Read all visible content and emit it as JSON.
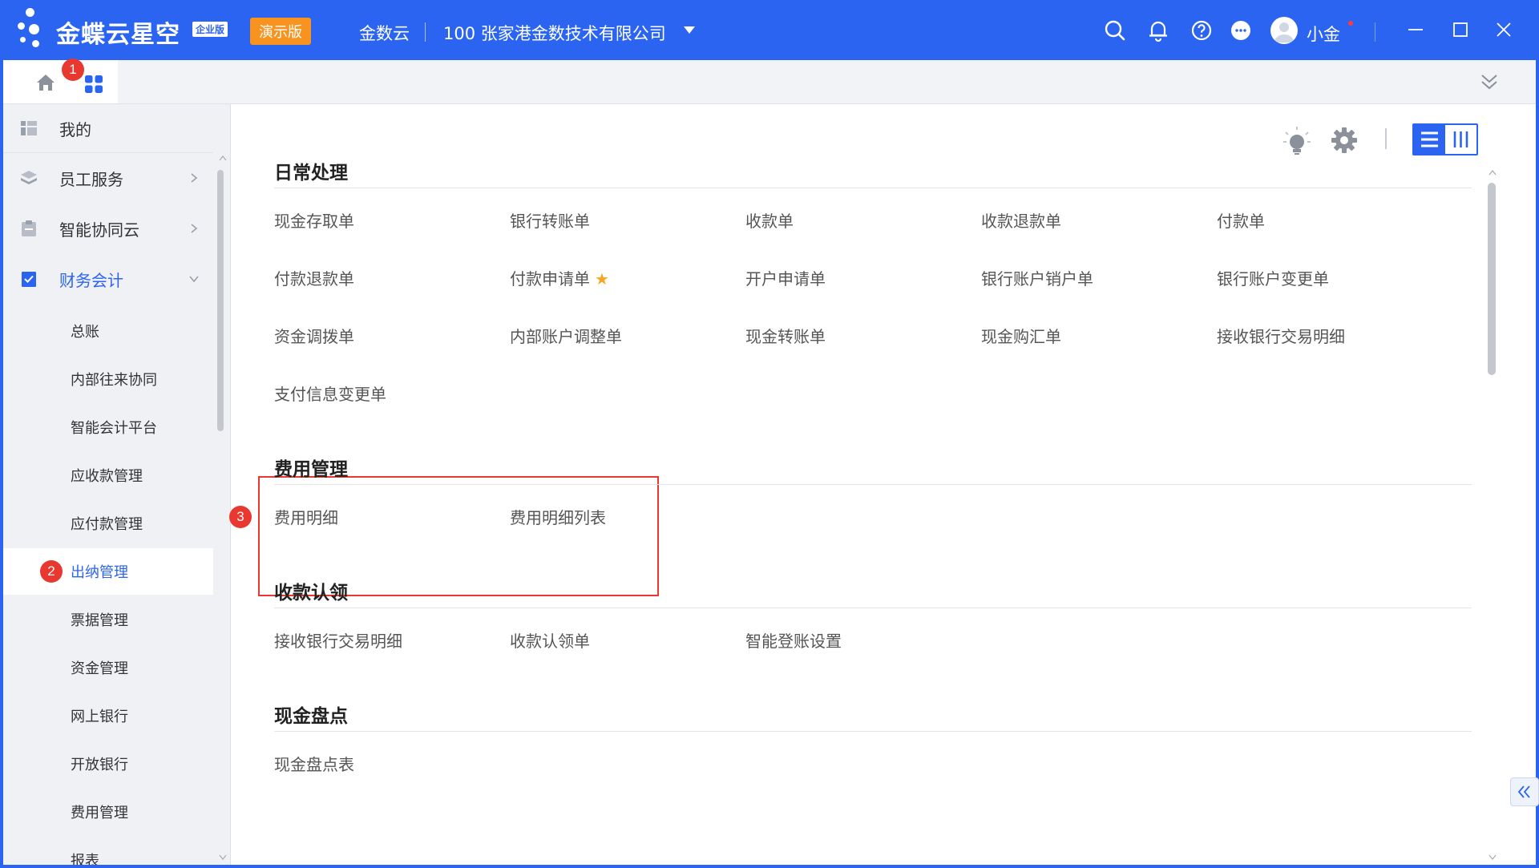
{
  "header": {
    "brand": "金蝶云星空",
    "edition_badge": "企业版",
    "demo_tag": "演示版",
    "app_name": "金数云",
    "org": "100  张家港金数技术有限公司",
    "username": "小金"
  },
  "tabs": {
    "home_icon": "home-icon",
    "apps_icon": "apps-grid-icon",
    "badge_1": "1"
  },
  "sidebar": {
    "items": [
      {
        "label": "我的",
        "icon": "my-icon"
      },
      {
        "label": "员工服务",
        "icon": "layers-icon"
      },
      {
        "label": "智能协同云",
        "icon": "clipboard-icon"
      },
      {
        "label": "财务会计",
        "icon": "finance-icon"
      }
    ],
    "sub_items": [
      "总账",
      "内部往来协同",
      "智能会计平台",
      "应收款管理",
      "应付款管理",
      "出纳管理",
      "票据管理",
      "资金管理",
      "网上银行",
      "开放银行",
      "费用管理",
      "报表"
    ],
    "badge_2": "2"
  },
  "main": {
    "sections": [
      {
        "title": "日常处理",
        "links": [
          "现金存取单",
          "银行转账单",
          "收款单",
          "收款退款单",
          "付款单",
          "付款退款单",
          "付款申请单",
          "开户申请单",
          "银行账户销户单",
          "银行账户变更单",
          "资金调拨单",
          "内部账户调整单",
          "现金转账单",
          "现金购汇单",
          "接收银行交易明细",
          "支付信息变更单"
        ]
      },
      {
        "title": "费用管理",
        "links": [
          "费用明细",
          "费用明细列表"
        ]
      },
      {
        "title": "收款认领",
        "links": [
          "接收银行交易明细",
          "收款认领单",
          "智能登账设置"
        ]
      },
      {
        "title": "现金盘点",
        "links": [
          "现金盘点表"
        ]
      }
    ],
    "badge_3": "3"
  },
  "colors": {
    "primary": "#2b64f0",
    "demo": "#f7931e",
    "highlight": "#e8382f",
    "star": "#f5a623"
  }
}
